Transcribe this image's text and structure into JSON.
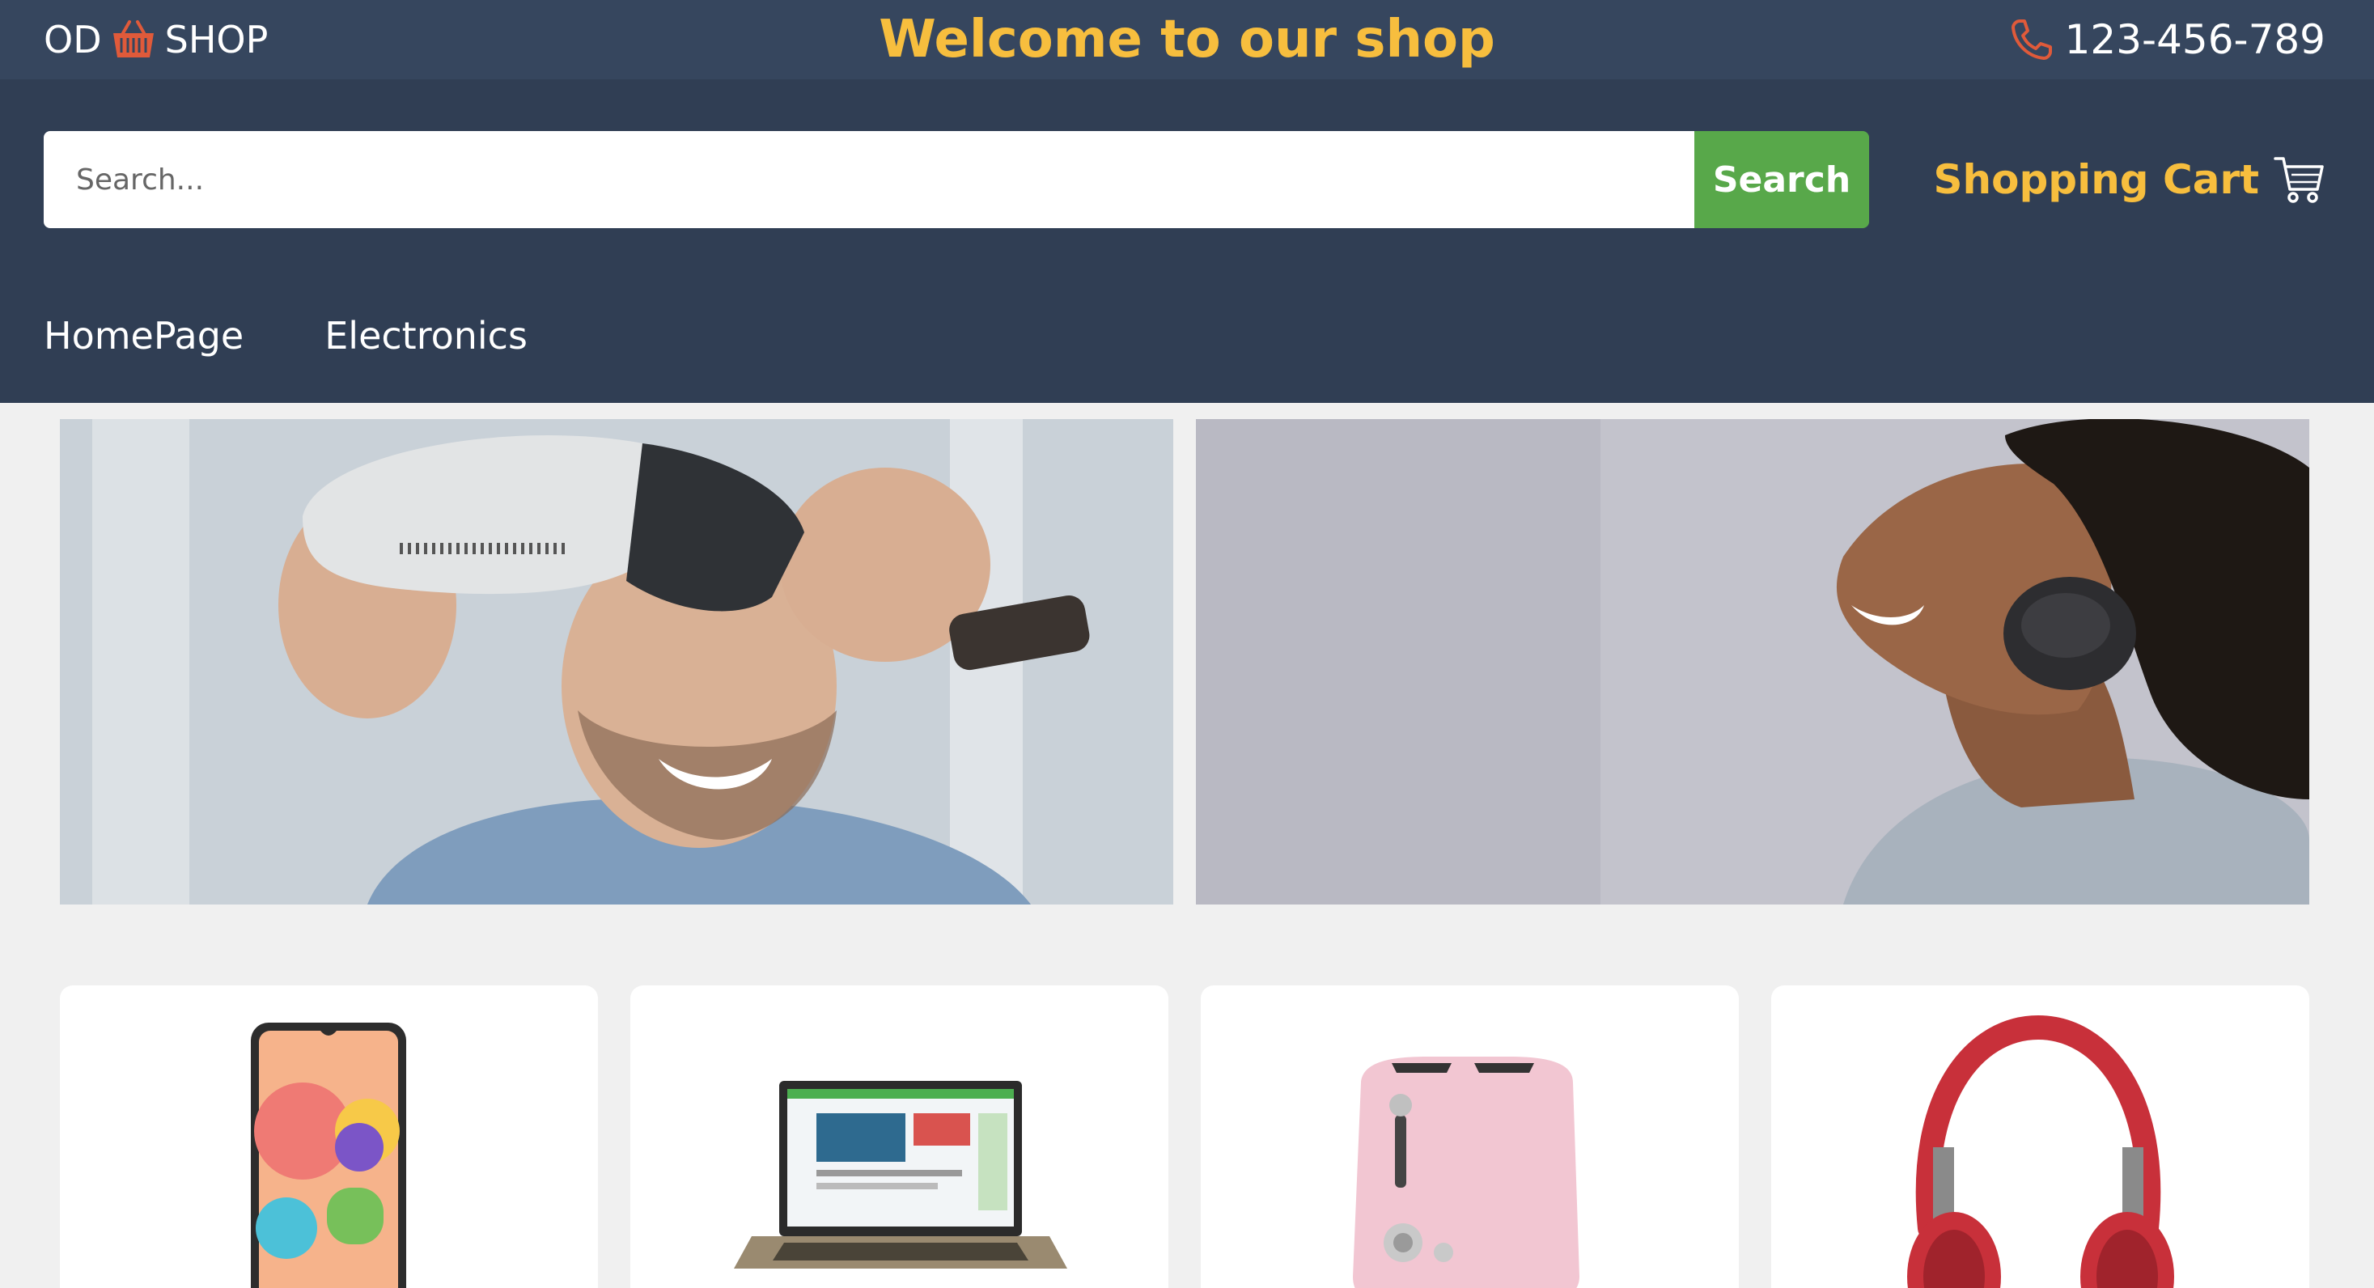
{
  "topbar": {
    "logo_left": "OD",
    "logo_right": "SHOP",
    "logo_icon": "basket-icon",
    "welcome": "Welcome to our shop",
    "phone": "123-456-789",
    "phone_icon": "phone-icon"
  },
  "search": {
    "placeholder": "Search...",
    "button_label": "Search"
  },
  "cart": {
    "label": "Shopping Cart",
    "icon": "cart-icon"
  },
  "nav": {
    "items": [
      {
        "label": "HomePage"
      },
      {
        "label": "Electronics"
      }
    ]
  },
  "banners": [
    {
      "subject": "man wearing VR headset"
    },
    {
      "subject": "woman wearing headphones"
    }
  ],
  "products": [
    {
      "subject": "smartphone"
    },
    {
      "subject": "laptop"
    },
    {
      "subject": "pink toaster"
    },
    {
      "subject": "red headphones"
    }
  ],
  "colors": {
    "topbar": "#36465e",
    "header": "#303e54",
    "accent": "#f7be3e",
    "search_button": "#58a84a",
    "basket": "#e05a3a"
  }
}
